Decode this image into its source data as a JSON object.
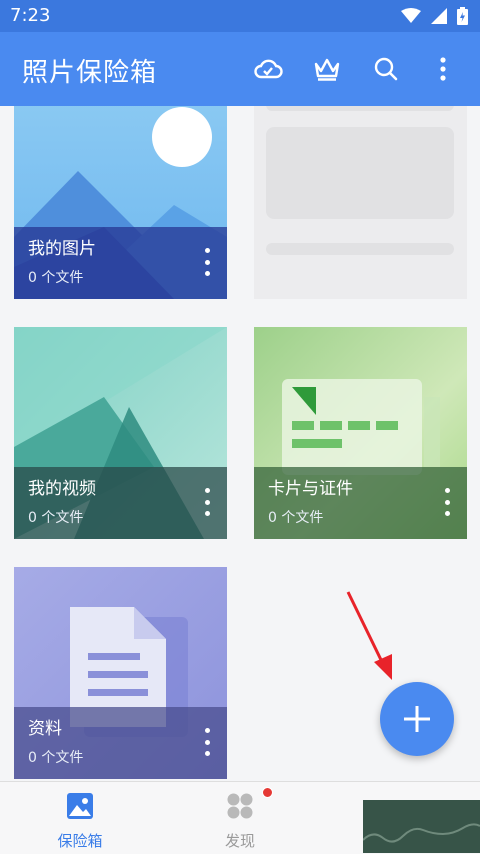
{
  "status_bar": {
    "time": "7:23"
  },
  "app_bar": {
    "title": "照片保险箱",
    "icons": [
      "cloud-icon",
      "crown-icon",
      "search-icon",
      "more-vert-icon"
    ]
  },
  "cards": [
    {
      "title": "我的图片",
      "count": "0 个文件",
      "icon": "image-illustration"
    },
    {
      "title": "我的视频",
      "count": "0 个文件",
      "icon": "video-illustration"
    },
    {
      "title": "卡片与证件",
      "count": "0 个文件",
      "icon": "card-illustration"
    },
    {
      "title": "资料",
      "count": "0 个文件",
      "icon": "document-illustration"
    }
  ],
  "fab": {
    "icon": "plus-icon"
  },
  "bottom_nav": [
    {
      "label": "保险箱",
      "icon": "vault-icon",
      "active": true
    },
    {
      "label": "发现",
      "icon": "discover-icon",
      "active": false
    }
  ],
  "colors": {
    "status_bar": "#3b78de",
    "app_bar": "#4a8af0",
    "nav_active": "#3a7de8",
    "nav_inactive": "#9a9a9a",
    "badge": "#e53935"
  }
}
